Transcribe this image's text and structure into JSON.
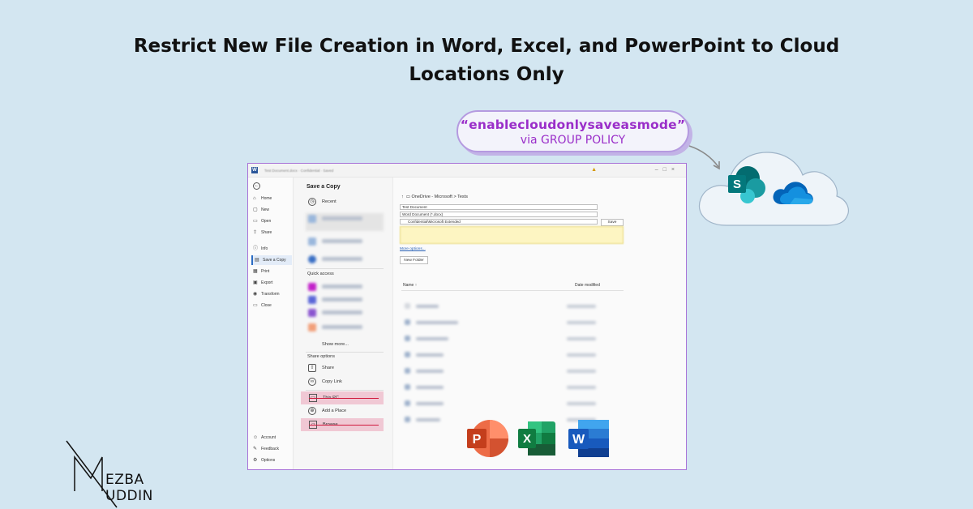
{
  "headline": {
    "line1": "Restrict New File Creation in Word, Excel, and PowerPoint to Cloud",
    "line2": "Locations Only"
  },
  "callout": {
    "policy": "“enablecloudonlysaveasmode”",
    "via": "via GROUP POLICY"
  },
  "cloud_apps": [
    {
      "icon": "sharepoint-icon",
      "letter": "S"
    },
    {
      "icon": "onedrive-icon"
    }
  ],
  "window": {
    "titlebar": {
      "doc_title": "Test Document.docx · Confidential · Saved"
    },
    "nav": [
      {
        "icon": "home-icon",
        "label": "Home"
      },
      {
        "icon": "new-icon",
        "label": "New"
      },
      {
        "icon": "open-icon",
        "label": "Open"
      },
      {
        "icon": "share-icon",
        "label": "Share"
      },
      {
        "icon": "info-icon",
        "label": "Info"
      },
      {
        "icon": "save-copy-icon",
        "label": "Save a Copy"
      },
      {
        "icon": "print-icon",
        "label": "Print"
      },
      {
        "icon": "export-icon",
        "label": "Export"
      },
      {
        "icon": "transform-icon",
        "label": "Transform"
      },
      {
        "icon": "close-icon",
        "label": "Close"
      }
    ],
    "nav_bottom": [
      {
        "icon": "account-icon",
        "label": "Account"
      },
      {
        "icon": "feedback-icon",
        "label": "Feedback"
      },
      {
        "icon": "options-icon",
        "label": "Options"
      }
    ],
    "middle": {
      "title": "Save a Copy",
      "recent": "Recent",
      "quick_access": "Quick access",
      "show_more": "Show more...",
      "share_options": "Share options",
      "share": "Share",
      "copy_link": "Copy Link",
      "this_pc": "This PC",
      "add_place": "Add a Place",
      "browse": "Browse"
    },
    "right": {
      "breadcrumb": "OneDrive - Microsoft > Tests",
      "filename": "Test Document",
      "filetype": "Word Document (*.docx)",
      "sensitivity": "Confidential\\Microsoft Extended",
      "save_label": "Save",
      "more_options": "More options...",
      "new_folder": "New Folder",
      "col_name": "Name ↑",
      "col_date": "Date modified"
    },
    "office_apps": [
      {
        "icon": "powerpoint-icon",
        "letter": "P"
      },
      {
        "icon": "excel-icon",
        "letter": "X"
      },
      {
        "icon": "word-icon",
        "letter": "W"
      }
    ]
  },
  "logo": {
    "text": "EZBA UDDIN",
    "icon": "mezba-uddin-logo"
  },
  "colors": {
    "background": "#d3e6f1",
    "accent": "#9a2ec9",
    "highlight": "#f0c8d4",
    "strike": "#d0193d"
  }
}
